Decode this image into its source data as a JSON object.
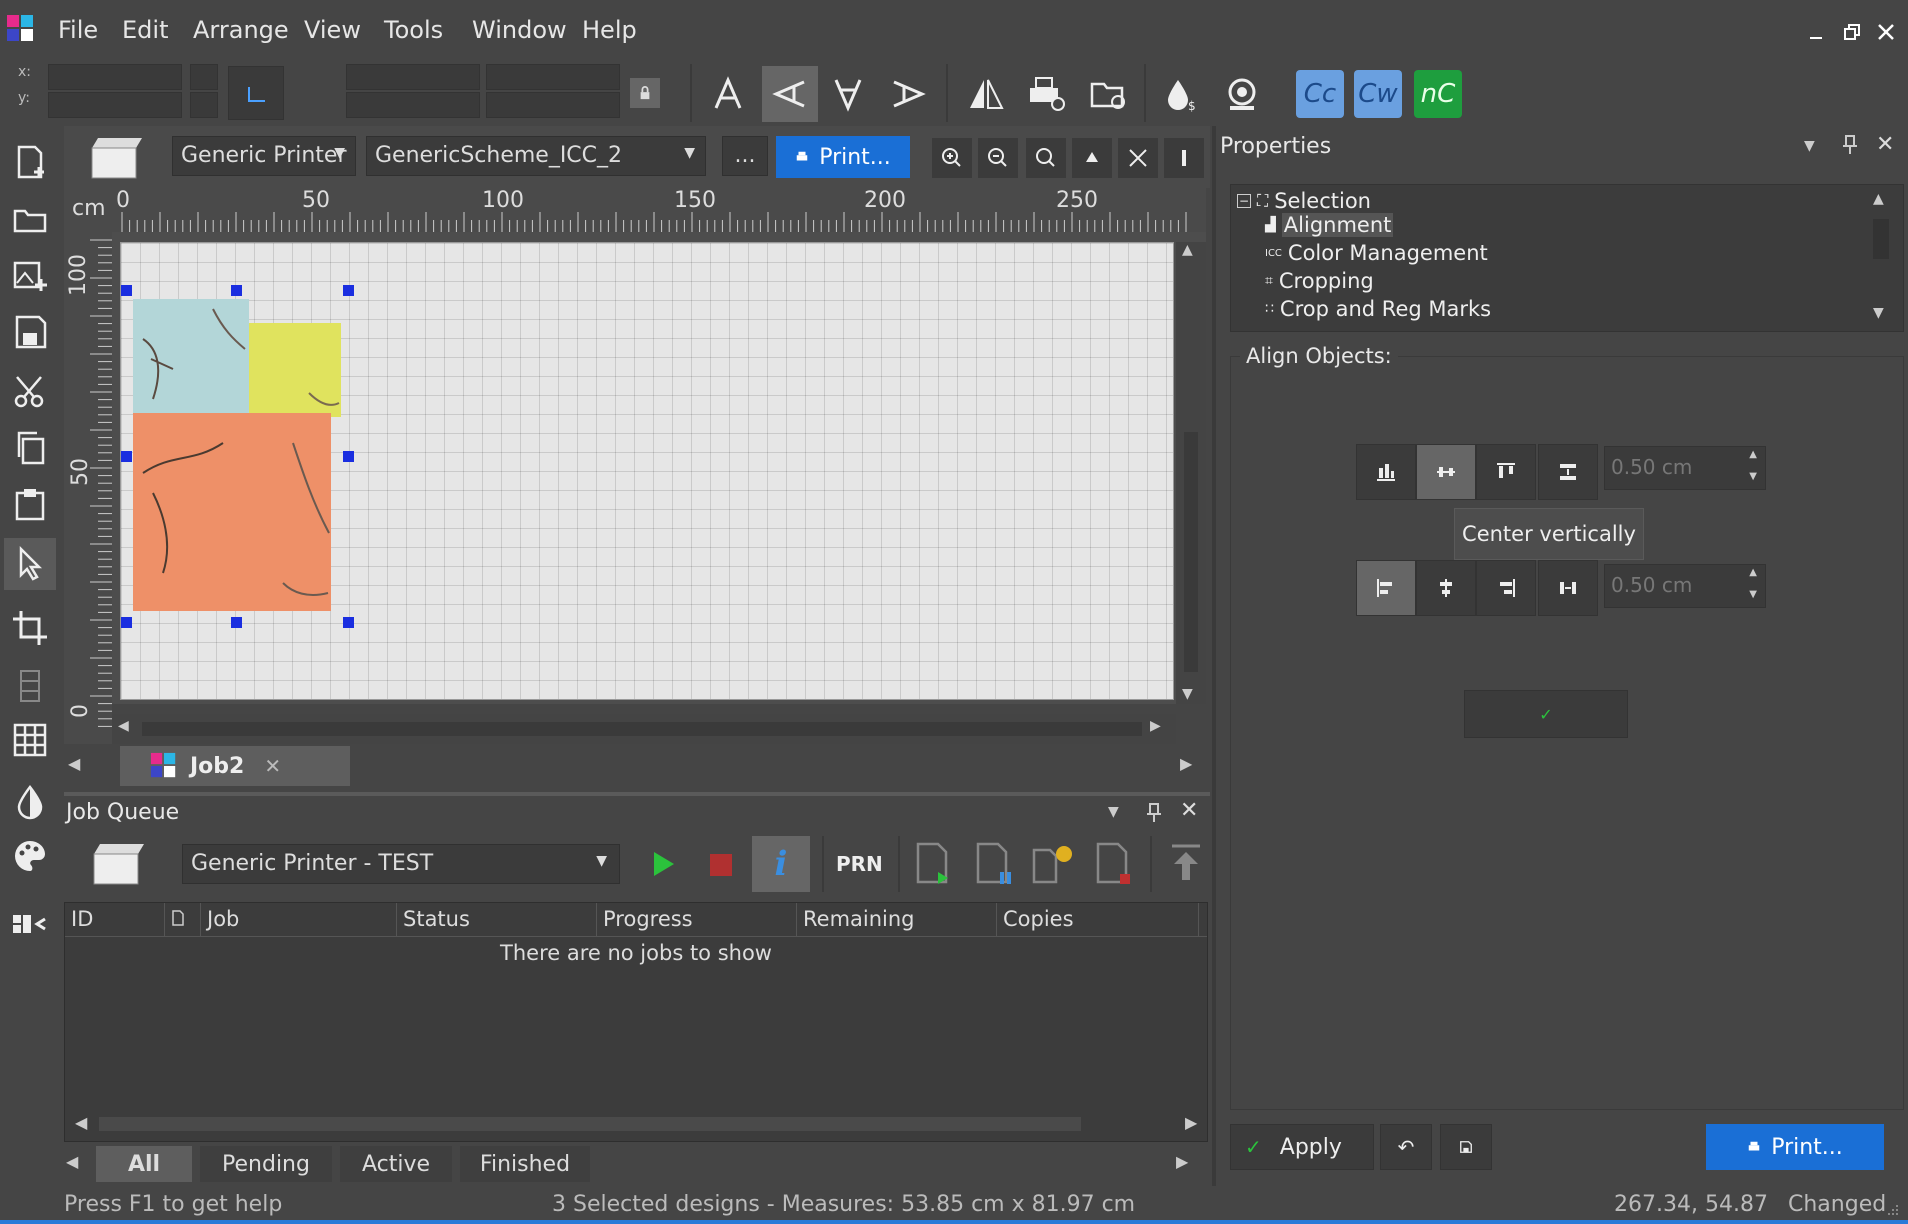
{
  "menu": {
    "items": [
      "File",
      "Edit",
      "Arrange",
      "View",
      "Tools",
      "Window",
      "Help"
    ]
  },
  "toolbar": {
    "x_label": "x:",
    "y_label": "y:",
    "app_badges": [
      "Cc",
      "Cw",
      "nC"
    ]
  },
  "document": {
    "printer": "Generic Printer",
    "scheme": "GenericScheme_ICC_2",
    "more_label": "...",
    "print_label": "Print...",
    "ruler_unit": "cm",
    "ruler_h_ticks": [
      "0",
      "50",
      "100",
      "150",
      "200",
      "250"
    ],
    "ruler_v_ticks": [
      "100",
      "50",
      "0"
    ],
    "tab_name": "Job2"
  },
  "properties": {
    "title": "Properties",
    "tree": {
      "root": "Selection",
      "items": [
        "Alignment",
        "Color Management",
        "Cropping",
        "Crop and Reg Marks"
      ]
    },
    "align_group_label": "Align Objects:",
    "spacing_1": "0.50 cm",
    "spacing_2": "0.50 cm",
    "tooltip": "Center vertically",
    "apply_label": "Apply",
    "print_label": "Print..."
  },
  "job_queue": {
    "title": "Job Queue",
    "printer": "Generic Printer - TEST",
    "prn_label": "PRN",
    "columns": [
      "ID",
      "Job",
      "Status",
      "Progress",
      "Remaining",
      "Copies"
    ],
    "empty_message": "There are no jobs to show",
    "tabs": [
      "All",
      "Pending",
      "Active",
      "Finished"
    ]
  },
  "status": {
    "help": "Press F1 to get help",
    "selection": "3 Selected designs - Measures: 53.85 cm x 81.97 cm",
    "coords": "267.34, 54.87",
    "state": "Changed"
  },
  "colors": {
    "accent": "#1a6fd6",
    "handle": "#1a2ee0",
    "design_teal": "#b3d6d8",
    "design_yellow": "#e0e35e",
    "design_orange": "#ee9068"
  }
}
